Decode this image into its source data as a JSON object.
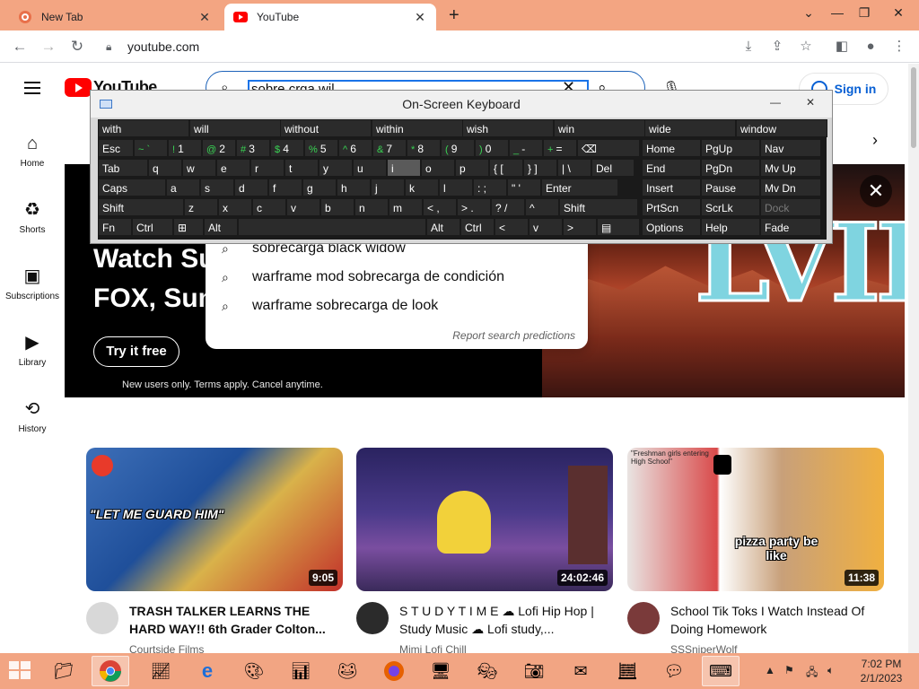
{
  "browser": {
    "tabs": [
      {
        "title": "New Tab",
        "icon": "firefox-style-icon"
      },
      {
        "title": "YouTube",
        "icon": "youtube-icon"
      }
    ],
    "url": "youtube.com"
  },
  "youtube": {
    "logo_text": "YouTube",
    "search_query": "sobre crga wil",
    "signin_label": "Sign in",
    "sidebar": [
      {
        "label": "Home",
        "icon": "home-icon"
      },
      {
        "label": "Shorts",
        "icon": "shorts-icon"
      },
      {
        "label": "Subscriptions",
        "icon": "subscriptions-icon"
      },
      {
        "label": "Library",
        "icon": "library-icon"
      },
      {
        "label": "History",
        "icon": "history-icon"
      }
    ],
    "banner": {
      "headline_1": "Watch Su",
      "headline_2": "FOX, Sun",
      "cta": "Try it free",
      "fine_print": "New users only. Terms apply. Cancel anytime."
    },
    "suggestions": [
      "sobrecarga black widow",
      "warframe mod sobrecarga de condición",
      "warframe sobrecarga de look"
    ],
    "report_label": "Report search predictions",
    "videos": [
      {
        "title": "TRASH TALKER LEARNS THE HARD WAY!! 6th Grader Colton...",
        "channel": "Courtside Films",
        "duration": "9:05",
        "caption": "\"LET ME GUARD HIM\""
      },
      {
        "title": "S T U D Y   T I M E ☁ Lofi Hip Hop | Study Music ☁ Lofi study,...",
        "channel": "Mimi Lofi Chill",
        "duration": "24:02:46",
        "caption": ""
      },
      {
        "title": "School Tik Toks I Watch Instead Of Doing Homework",
        "channel": "SSSniperWolf",
        "duration": "11:38",
        "caption": "pizza party be like",
        "caption_top": "\"Freshman girls entering High School\""
      }
    ]
  },
  "osk": {
    "title": "On-Screen Keyboard",
    "predictions": [
      "with",
      "will",
      "without",
      "within",
      "wish",
      "win",
      "wide",
      "window"
    ],
    "row1": {
      "esc": "Esc",
      "backspace": "⌫"
    },
    "keys_num": [
      {
        "top": "~",
        "sub": "`",
        "main": ""
      },
      {
        "top": "!",
        "sub": "",
        "main": "1"
      },
      {
        "top": "@",
        "sub": "",
        "main": "2"
      },
      {
        "top": "#",
        "sub": "",
        "main": "3"
      },
      {
        "top": "$",
        "sub": "",
        "main": "4"
      },
      {
        "top": "%",
        "sub": "",
        "main": "5"
      },
      {
        "top": "^",
        "sub": "",
        "main": "6"
      },
      {
        "top": "&",
        "sub": "",
        "main": "7"
      },
      {
        "top": "*",
        "sub": "",
        "main": "8"
      },
      {
        "top": "(",
        "sub": "",
        "main": "9"
      },
      {
        "top": ")",
        "sub": "",
        "main": "0"
      },
      {
        "top": "_",
        "sub": "",
        "main": "-"
      },
      {
        "top": "+",
        "sub": "",
        "main": "="
      }
    ],
    "row2": [
      "Tab",
      "q",
      "w",
      "e",
      "r",
      "t",
      "y",
      "u",
      "i",
      "o",
      "p",
      "{ [",
      "} ]",
      "| \\",
      "Del"
    ],
    "row3": [
      "Caps",
      "a",
      "s",
      "d",
      "f",
      "g",
      "h",
      "j",
      "k",
      "l",
      ": ;",
      "\" '",
      "Enter"
    ],
    "row4": [
      "Shift",
      "z",
      "x",
      "c",
      "v",
      "b",
      "n",
      "m",
      "< ,",
      "> .",
      "? /",
      "^",
      "Shift"
    ],
    "row5": [
      "Fn",
      "Ctrl",
      "⊞",
      "Alt",
      "",
      "Alt",
      "Ctrl",
      "<",
      "v",
      ">",
      "▤"
    ],
    "nav": [
      [
        "Home",
        "PgUp",
        "Nav"
      ],
      [
        "End",
        "PgDn",
        "Mv Up"
      ],
      [
        "Insert",
        "Pause",
        "Mv Dn"
      ],
      [
        "PrtScn",
        "ScrLk",
        "Dock"
      ],
      [
        "Options",
        "Help",
        "Fade"
      ]
    ]
  },
  "taskbar": {
    "time": "7:02 PM",
    "date": "2/1/2023"
  }
}
